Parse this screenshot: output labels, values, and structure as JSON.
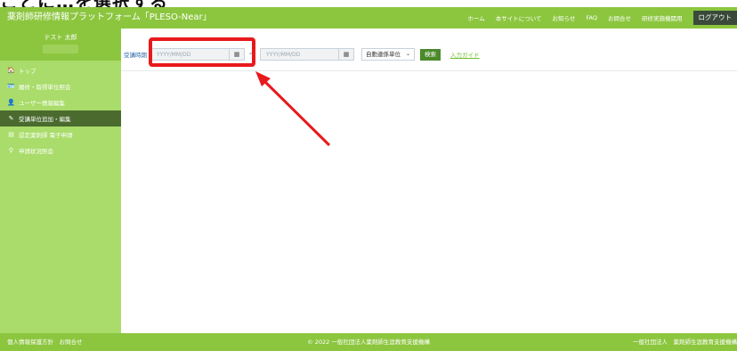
{
  "caption": "ことに…を選択する",
  "header": {
    "brand": "薬剤師研修情報プラットフォーム「PLESO-Near」",
    "nav": [
      "ホーム",
      "本サイトについて",
      "お知らせ",
      "FAQ",
      "お問合せ",
      "研修実施機関用"
    ],
    "logout": "ログアウト"
  },
  "sidebar": {
    "user_name": "テスト 太郎",
    "items": [
      {
        "icon": "home-icon",
        "glyph": "🏠",
        "label": "トップ"
      },
      {
        "icon": "id-card-icon",
        "glyph": "🪪",
        "label": "履修・取得単位照会"
      },
      {
        "icon": "user-icon",
        "glyph": "👤",
        "label": "ユーザー情報編集"
      },
      {
        "icon": "edit-icon",
        "glyph": "✎",
        "label": "受講単位追加・編集"
      },
      {
        "icon": "document-icon",
        "glyph": "▤",
        "label": "認定薬剤師 電子申請"
      },
      {
        "icon": "search-icon",
        "glyph": "⚲",
        "label": "申請状況照会"
      }
    ]
  },
  "filter": {
    "label": "受講時期",
    "date_from_placeholder": "YYYY/MM/DD",
    "separator": "〜",
    "date_to_placeholder": "YYYY/MM/DD",
    "select_value": "自動連係単位",
    "search_label": "検索",
    "guide_label": "入力ガイド"
  },
  "footer": {
    "left": "個人情報保護方針　お問合せ",
    "center": "© 2022 一般社団法人薬剤師生涯教育支援機構",
    "right": "一般社団法人　薬剤師生涯教育支援機構"
  },
  "colors": {
    "header": "#8cc63f",
    "sidebar": "#a9dc6a",
    "active": "#4a6a2e",
    "highlight": "#e8191c",
    "arrow": "#e8191c"
  }
}
